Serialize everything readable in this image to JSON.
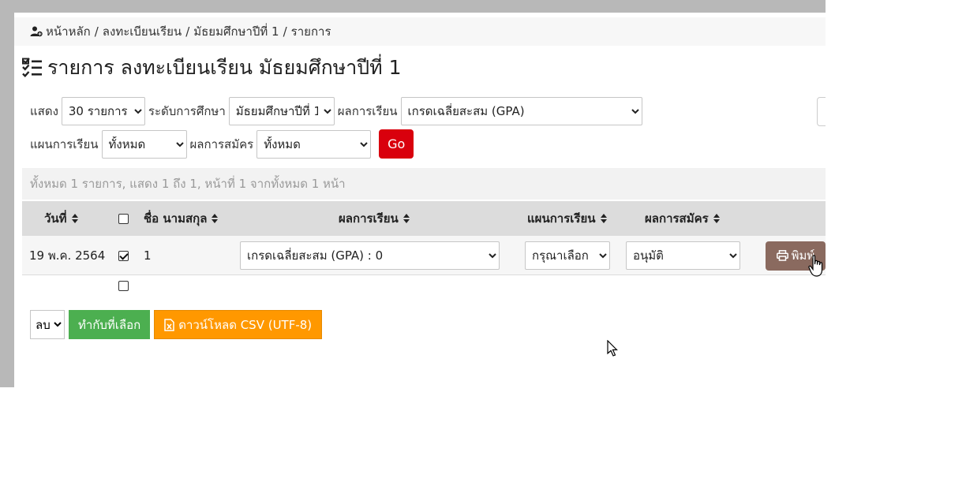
{
  "breadcrumb": {
    "home": "หน้าหลัก",
    "section": "ลงทะเบียนเรียน",
    "level": "มัธยมศึกษาปีที่ 1",
    "current": "รายการ",
    "separator": "/"
  },
  "page_title": "รายการ ลงทะเบียนเรียน มัธยมศึกษาปีที่ 1",
  "filters": {
    "show_label": "แสดง",
    "show_value": "30 รายการ",
    "level_label": "ระดับการศึกษา",
    "level_value": "มัธยมศึกษาปีที่ 1",
    "result_label": "ผลการเรียน",
    "result_value": "เกรดเฉลี่ยสะสม (GPA)",
    "plan_label": "แผนการเรียน",
    "plan_value": "ทั้งหมด",
    "apply_label": "ผลการสมัคร",
    "apply_value": "ทั้งหมด",
    "go_label": "Go"
  },
  "summary": "ทั้งหมด 1 รายการ, แสดง 1 ถึง 1, หน้าที่ 1 จากทั้งหมด 1 หน้า",
  "table": {
    "headers": {
      "date": "วันที่",
      "name": "ชื่อ นามสกุล",
      "result": "ผลการเรียน",
      "plan": "แผนการเรียน",
      "apply": "ผลการสมัคร"
    },
    "rows": [
      {
        "date": "19 พ.ค. 2564",
        "checked": true,
        "name": "1",
        "result": "เกรดเฉลี่ยสะสม (GPA) : 0",
        "plan": "กรุณาเลือก",
        "apply": "อนุมัติ",
        "print_label": "พิมพ์"
      }
    ]
  },
  "actions": {
    "action_value": "ลบ",
    "apply_selected": "ทำกับที่เลือก",
    "download_csv": "ดาวน์โหลด CSV (UTF-8)"
  },
  "colors": {
    "go": "#d9000d",
    "print": "#8a6a5f",
    "apply_selected": "#4caf50",
    "download_csv": "#ff9800"
  },
  "icons": {
    "breadcrumb": "user-plus-icon",
    "title": "checklist-icon",
    "sort": "sort-icon",
    "print": "printer-icon",
    "csv": "excel-file-icon"
  }
}
